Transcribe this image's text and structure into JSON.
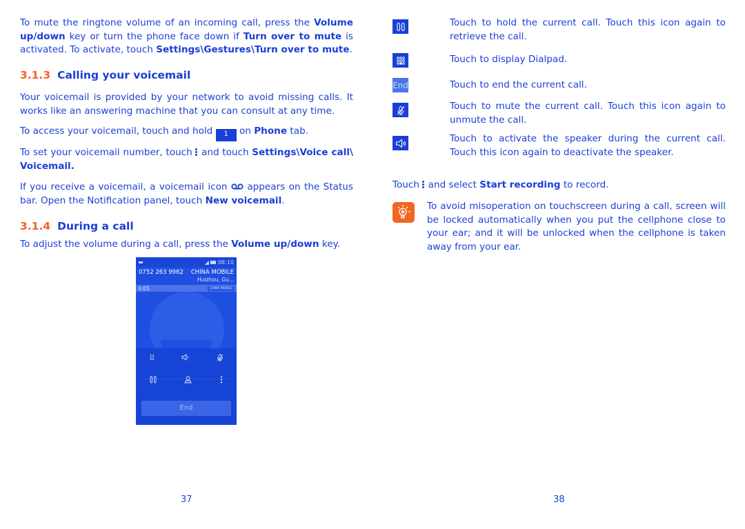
{
  "left_page": {
    "intro": {
      "t1": "To mute the ringtone volume of an incoming call, press the ",
      "b1": "Volume up/down",
      "t2": " key or turn the phone face down if ",
      "b2": "Turn over to mute",
      "t3": " is activated. To activate, touch ",
      "b3": "Settings\\Gestures\\Turn over to mute",
      "t4": "."
    },
    "section_voicemail": {
      "number": "3.1.3",
      "title": "Calling your voicemail",
      "para1": "Your voicemail is provided by your network to avoid missing calls. It works like an answering machine that you can consult at any time.",
      "para2": {
        "t1": "To access your voicemail, touch and hold ",
        "key_label": "1",
        "t2": " on ",
        "b1": "Phone",
        "t3": " tab."
      },
      "para3": {
        "t1": "To set your voicemail number, touch ",
        "t2": " and touch ",
        "b1": "Settings\\Voice call\\ Voicemail."
      },
      "para4": {
        "t1": "If you receive a voicemail, a voicemail icon ",
        "t2": " appears on the Status bar. Open the Notification panel, touch ",
        "b1": "New voicemail",
        "t3": "."
      }
    },
    "section_call": {
      "number": "3.1.4",
      "title": "During a call",
      "para1": {
        "t1": "To adjust the volume during a call, press the ",
        "b1": "Volume up/down",
        "t2": " key."
      }
    },
    "phone_screen": {
      "status_time": "08:10",
      "phone_number": "0752 263 9962",
      "carrier": "CHINA MOBILE",
      "location": "Huizhou, Gu...",
      "call_timer": "0:05",
      "sim_chip": "CHINA MOBILE",
      "end_label": "End"
    },
    "page_number": "37"
  },
  "right_page": {
    "icons": [
      {
        "icon": "hold-icon",
        "glyph": "▯▯",
        "text": "Touch to hold the current call. Touch this icon again to retrieve the call."
      },
      {
        "icon": "dialpad-icon",
        "glyph": "⠿",
        "text": "Touch to display Dialpad."
      },
      {
        "icon": "end-icon",
        "glyph": "End",
        "text": "Touch to end the current call."
      },
      {
        "icon": "mute-icon",
        "glyph": "",
        "text": "Touch to mute the current call. Touch this icon again to unmute the call."
      },
      {
        "icon": "speaker-icon",
        "glyph": "",
        "text": "Touch to activate the speaker during the current call. Touch this icon again to deactivate the speaker."
      }
    ],
    "record": {
      "t1": "Touch ",
      "t2": " and select ",
      "b1": "Start recording",
      "t3": " to record."
    },
    "tip": "To avoid misoperation on touchscreen during a call, screen will be locked automatically when you put the cellphone close to your ear; and it will be unlocked when the cellphone is taken away from your ear.",
    "page_number": "38"
  },
  "colors": {
    "text": "#1a3fd6",
    "accent": "#f26522",
    "phone_bg": "#1e4fe0"
  }
}
